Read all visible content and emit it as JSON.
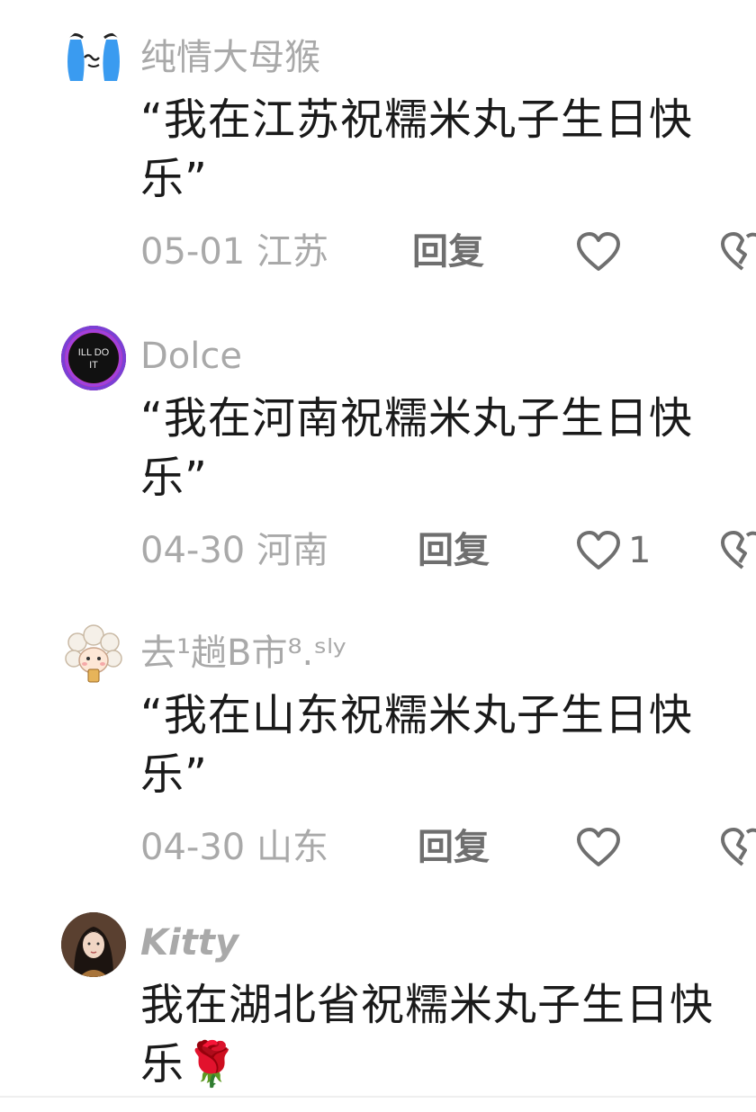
{
  "comments": [
    {
      "username": "纯情大母猴",
      "text": "“我在江苏祝糯米丸子生日快乐”",
      "date_location": "05-01 江苏",
      "reply_label": "回复",
      "like_count": ""
    },
    {
      "username": "Dolce",
      "text": "“我在河南祝糯米丸子生日快乐”",
      "date_location": "04-30 河南",
      "reply_label": "回复",
      "like_count": "1",
      "avatar_text": "ILL DO IT"
    },
    {
      "username": "去¹趟B市⁸.ˢˡʸ",
      "text": "“我在山东祝糯米丸子生日快乐”",
      "date_location": "04-30 山东",
      "reply_label": "回复",
      "like_count": ""
    },
    {
      "username": "Kitty",
      "text": "我在湖北省祝糯米丸子生日快乐🌹"
    }
  ],
  "colors": {
    "muted_text": "#a9a9a9",
    "body_text": "#1a1a1a",
    "action_text": "#6f6f6f",
    "icon_stroke": "#6f6f6f"
  }
}
